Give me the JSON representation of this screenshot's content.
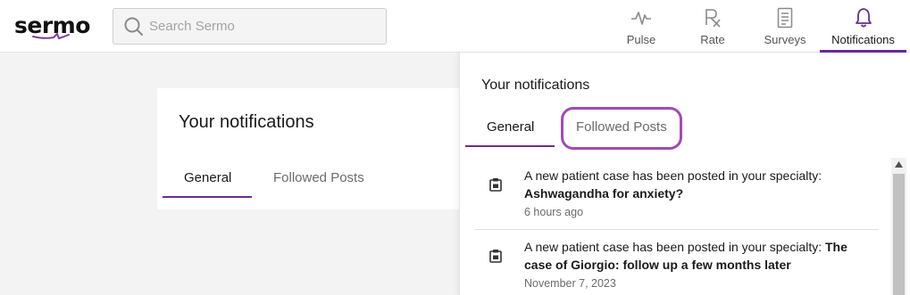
{
  "header": {
    "logo": "sermo",
    "search_placeholder": "Search Sermo",
    "nav": [
      {
        "label": "Pulse",
        "icon": "pulse-icon"
      },
      {
        "label": "Rate",
        "icon": "rx-icon"
      },
      {
        "label": "Surveys",
        "icon": "clipboard-icon"
      },
      {
        "label": "Notifications",
        "icon": "bell-icon"
      }
    ]
  },
  "page": {
    "title": "Your notifications",
    "tabs": [
      "General",
      "Followed Posts"
    ]
  },
  "panel": {
    "title": "Your notifications",
    "tabs": [
      "General",
      "Followed Posts"
    ],
    "notifications": [
      {
        "text": "A new patient case has been posted in your specialty: ",
        "title": "Ashwagandha for anxiety?",
        "time": "6 hours ago",
        "icon": "clipboard-case-icon"
      },
      {
        "text": "A new patient case has been posted in your specialty: ",
        "title": "The case of Giorgio: follow up a few months later",
        "time": "November 7, 2023",
        "icon": "clipboard-case-icon"
      }
    ]
  },
  "colors": {
    "accent": "#6a2d91",
    "highlight_ring": "#a24bb5",
    "background": "#f3f3f3"
  }
}
